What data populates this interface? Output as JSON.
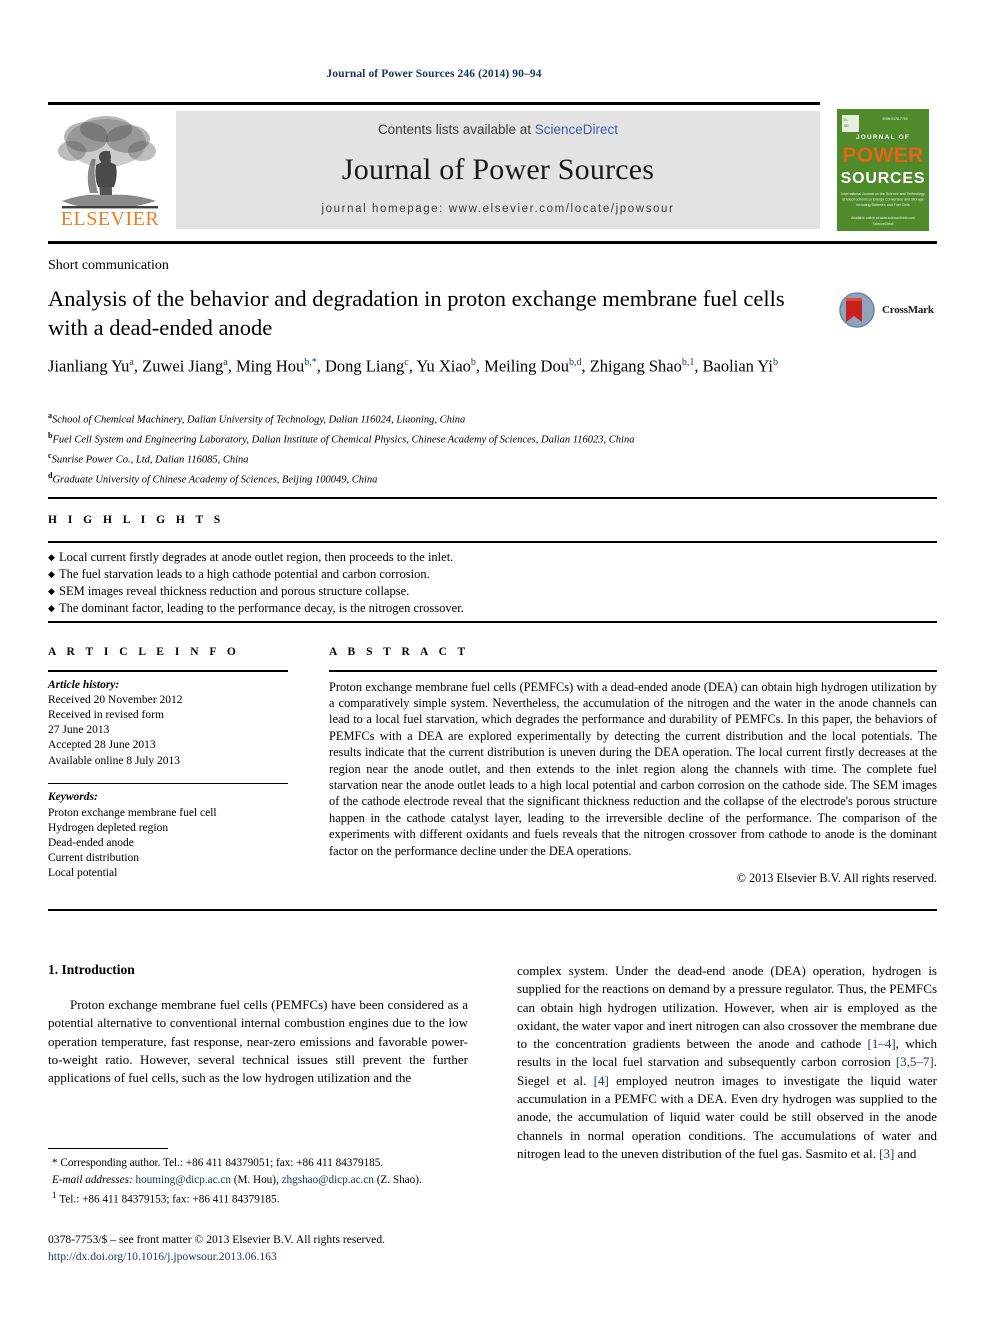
{
  "running_head": "Journal of Power Sources 246 (2014) 90–94",
  "masthead": {
    "contents_prefix": "Contents lists available at ",
    "sciencedirect": "ScienceDirect",
    "journal_title": "Journal of Power Sources",
    "homepage": "journal homepage: www.elsevier.com/locate/jpowsour",
    "publisher_wordmark": "ELSEVIER",
    "cover": {
      "line1": "JOURNAL OF",
      "line2": "POWER",
      "line3": "SOURCES",
      "blurb": "International Journal on the Science and Technology of Electrochemical Energy Conversion and Storage including Batteries and Fuel Cells",
      "footer": "Available online at www.sciencedirect.com",
      "bg_color": "#4f8a2b"
    },
    "colors": {
      "sciencedirect_blue": "#3b5ea8",
      "elsevier_orange": "#f07e20",
      "box_gray": "#e3e3e3"
    }
  },
  "article": {
    "doctype": "Short communication",
    "title": "Analysis of the behavior and degradation in proton exchange membrane fuel cells with a dead-ended anode",
    "authors": [
      {
        "name": "Jianliang Yu",
        "sup": "a",
        "sep": ", "
      },
      {
        "name": "Zuwei Jiang",
        "sup": "a",
        "sep": ", "
      },
      {
        "name": "Ming Hou",
        "sup": "b,*",
        "sep": ", "
      },
      {
        "name": "Dong Liang",
        "sup": "c",
        "sep": ", "
      },
      {
        "name": "Yu Xiao",
        "sup": "b",
        "sep": ", "
      },
      {
        "name": "Meiling Dou",
        "sup": "b,d",
        "sep": ", "
      },
      {
        "name": "Zhigang Shao",
        "sup": "b,1",
        "sep": ", "
      },
      {
        "name": "Baolian Yi",
        "sup": "b",
        "sep": ""
      }
    ],
    "affiliations": [
      {
        "mark": "a",
        "text": "School of Chemical Machinery, Dalian University of Technology, Dalian 116024, Liaoning, China"
      },
      {
        "mark": "b",
        "text": "Fuel Cell System and Engineering Laboratory, Dalian Institute of Chemical Physics, Chinese Academy of Sciences, Dalian 116023, China"
      },
      {
        "mark": "c",
        "text": "Sunrise Power Co., Ltd, Dalian 116085, China"
      },
      {
        "mark": "d",
        "text": "Graduate University of Chinese Academy of Sciences, Beijing 100049, China"
      }
    ],
    "crossmark_label": "CrossMark"
  },
  "highlights": {
    "heading": "H I G H L I G H T S",
    "bullet_glyph": "◆",
    "items": [
      "Local current firstly degrades at anode outlet region, then proceeds to the inlet.",
      "The fuel starvation leads to a high cathode potential and carbon corrosion.",
      "SEM images reveal thickness reduction and porous structure collapse.",
      "The dominant factor, leading to the performance decay, is the nitrogen crossover."
    ]
  },
  "article_info": {
    "heading": "A R T I C L E   I N F O",
    "history_label": "Article history:",
    "history": [
      "Received 20 November 2012",
      "Received in revised form",
      "27 June 2013",
      "Accepted 28 June 2013",
      "Available online 8 July 2013"
    ],
    "keywords_label": "Keywords:",
    "keywords": [
      "Proton exchange membrane fuel cell",
      "Hydrogen depleted region",
      "Dead-ended anode",
      "Current distribution",
      "Local potential"
    ]
  },
  "abstract": {
    "heading": "A B S T R A C T",
    "text": "Proton exchange membrane fuel cells (PEMFCs) with a dead-ended anode (DEA) can obtain high hydrogen utilization by a comparatively simple system. Nevertheless, the accumulation of the nitrogen and the water in the anode channels can lead to a local fuel starvation, which degrades the performance and durability of PEMFCs. In this paper, the behaviors of PEMFCs with a DEA are explored experimentally by detecting the current distribution and the local potentials. The results indicate that the current distribution is uneven during the DEA operation. The local current firstly decreases at the region near the anode outlet, and then extends to the inlet region along the channels with time. The complete fuel starvation near the anode outlet leads to a high local potential and carbon corrosion on the cathode side. The SEM images of the cathode electrode reveal that the significant thickness reduction and the collapse of the electrode's porous structure happen in the cathode catalyst layer, leading to the irreversible decline of the performance. The comparison of the experiments with different oxidants and fuels reveals that the nitrogen crossover from cathode to anode is the dominant factor on the performance decline under the DEA operations.",
    "copyright": "© 2013 Elsevier B.V. All rights reserved."
  },
  "body": {
    "section_number_title": "1. Introduction",
    "left_paragraph": "Proton exchange membrane fuel cells (PEMFCs) have been considered as a potential alternative to conventional internal combustion engines due to the low operation temperature, fast response, near-zero emissions and favorable power-to-weight ratio. However, several technical issues still prevent the further applications of fuel cells, such as the low hydrogen utilization and the",
    "right_paragraph_parts": [
      {
        "t": "complex system. Under the dead-end anode (DEA) operation, hydrogen is supplied for the reactions on demand by a pressure regulator. Thus, the PEMFCs can obtain high hydrogen utilization. However, when air is employed as the oxidant, the water vapor and inert nitrogen can also crossover the membrane due to the concentration gradients between the anode and cathode ",
        "ref": false
      },
      {
        "t": "[1–4]",
        "ref": true
      },
      {
        "t": ", which results in the local fuel starvation and subsequently carbon corrosion ",
        "ref": false
      },
      {
        "t": "[3,5–7]",
        "ref": true
      },
      {
        "t": ". Siegel et al. ",
        "ref": false
      },
      {
        "t": "[4]",
        "ref": true
      },
      {
        "t": " employed neutron images to investigate the liquid water accumulation in a PEMFC with a DEA. Even dry hydrogen was supplied to the anode, the accumulation of liquid water could be still observed in the anode channels in normal operation conditions. The accumulations of water and nitrogen lead to the uneven distribution of the fuel gas. Sasmito et al. ",
        "ref": false
      },
      {
        "t": "[3]",
        "ref": true
      },
      {
        "t": " and",
        "ref": false
      }
    ]
  },
  "footnotes": {
    "corresponding": "* Corresponding author. Tel.: +86 411 84379051; fax: +86 411 84379185.",
    "email_label": "E-mail addresses:",
    "email1": "houming@dicp.ac.cn",
    "email1_owner": "(M. Hou),",
    "email2": "zhgshao@dicp.ac.cn",
    "email2_owner": "(Z. Shao).",
    "note1_mark": "1",
    "note1": "Tel.: +86 411 84379153; fax: +86 411 84379185.",
    "issn_line": "0378-7753/$ – see front matter © 2013 Elsevier B.V. All rights reserved.",
    "doi_line": "http://dx.doi.org/10.1016/j.jpowsour.2013.06.163"
  }
}
